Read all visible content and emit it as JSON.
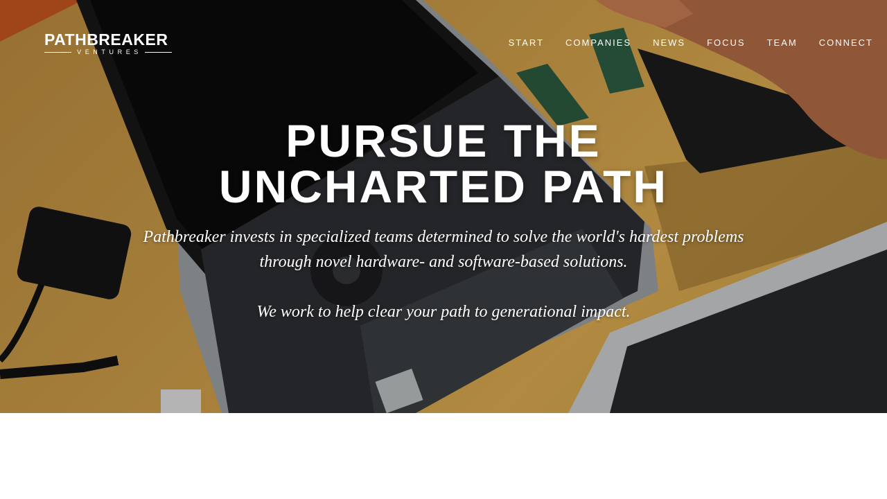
{
  "logo": {
    "main": "PATHBREAKER",
    "sub": "VENTURES"
  },
  "nav": {
    "items": [
      {
        "label": "START"
      },
      {
        "label": "COMPANIES"
      },
      {
        "label": "NEWS"
      },
      {
        "label": "FOCUS"
      },
      {
        "label": "TEAM"
      },
      {
        "label": "CONNECT"
      }
    ]
  },
  "hero": {
    "headline_line1": "PURSUE THE",
    "headline_line2": "UNCHARTED PATH",
    "description": "Pathbreaker invests in specialized teams determined to solve the world's hardest problems through novel hardware- and software-based solutions.",
    "tagline": "We work to help clear your path to generational impact."
  },
  "colors": {
    "hero_background": "#c99a48",
    "text": "#ffffff",
    "page_background": "#ffffff"
  },
  "icons": {
    "background_image": "laptop-repair-photo"
  }
}
